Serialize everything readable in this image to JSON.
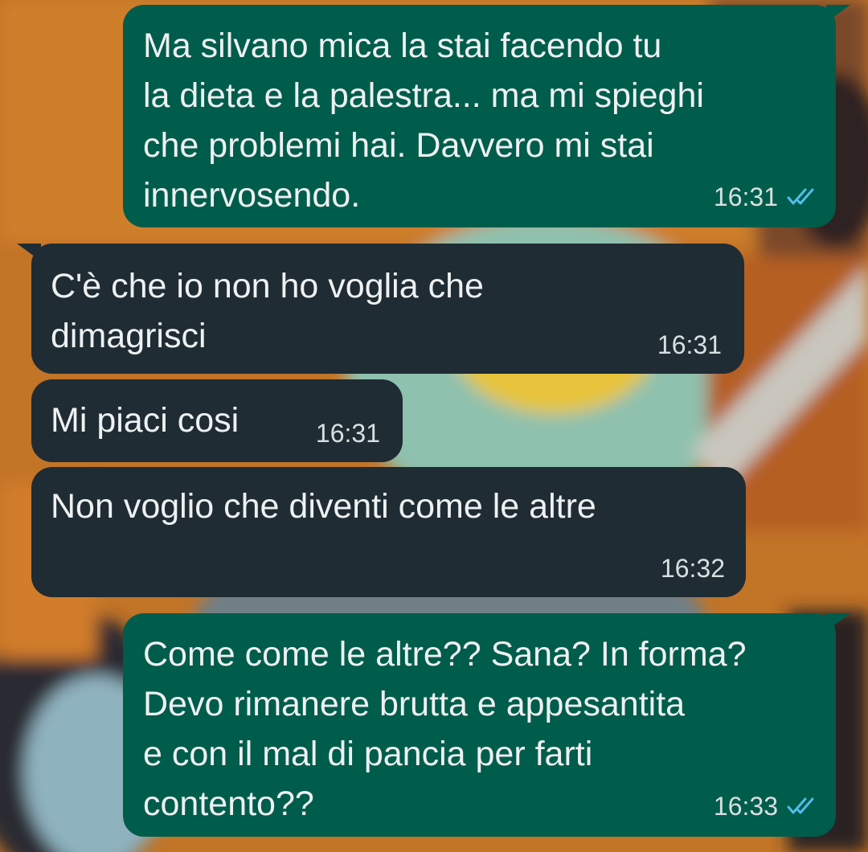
{
  "colors": {
    "outgoing_bubble": "#005c4b",
    "incoming_bubble": "#1f2c34",
    "read_ticks": "#53bdeb",
    "text": "#eef1f1"
  },
  "messages": [
    {
      "direction": "outgoing",
      "text": "Ma silvano mica la stai facendo tu\nla dieta e la palestra... ma mi spieghi\nche problemi hai. Davvero mi stai\ninnervosendo.",
      "time": "16:31",
      "status_icon": "double-check-read-icon"
    },
    {
      "direction": "incoming",
      "text": "C'è che io non ho voglia che\ndimagrisci",
      "time": "16:31"
    },
    {
      "direction": "incoming",
      "text": "Mi piaci cosi",
      "time": "16:31"
    },
    {
      "direction": "incoming",
      "text": "Non voglio che diventi come le altre",
      "time": "16:32"
    },
    {
      "direction": "outgoing",
      "text": "Come come le altre?? Sana? In forma?\nDevo rimanere brutta e appesantita\ne con il mal di pancia per farti\ncontento??",
      "time": "16:33",
      "status_icon": "double-check-read-icon"
    }
  ]
}
